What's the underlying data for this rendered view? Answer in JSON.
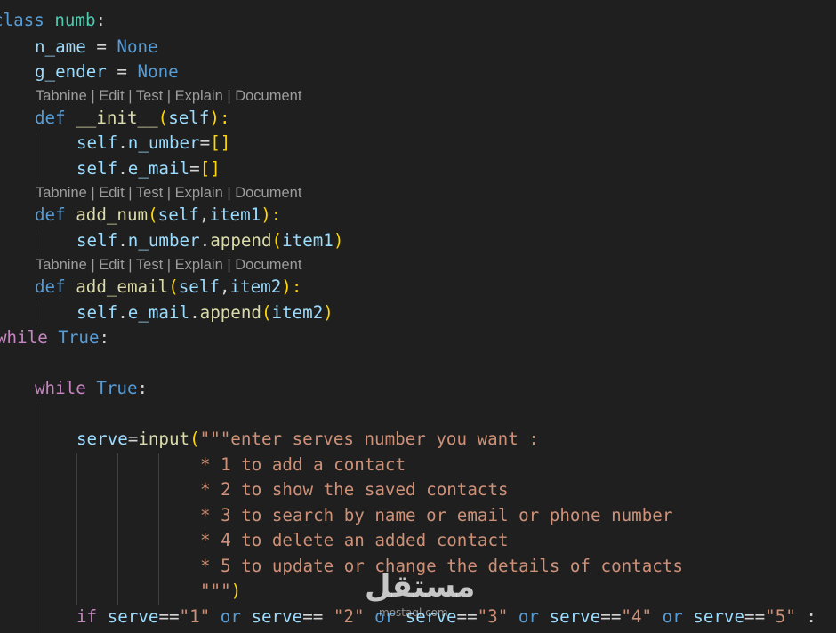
{
  "editor": {
    "l1": {
      "kw": "class",
      "name": "numb",
      "colon": ":"
    },
    "l2": {
      "var": "n_ame",
      "eq": " = ",
      "val": "None"
    },
    "l3": {
      "var": "g_ender",
      "eq": " = ",
      "val": "None"
    },
    "lens_items": [
      "Tabnine",
      "Edit",
      "Test",
      "Explain",
      "Document"
    ],
    "lens_sep": " | ",
    "l4": {
      "kw": "def",
      "fn": "__init__",
      "op": "(",
      "self": "self",
      "cp": "):"
    },
    "l5": {
      "self": "self",
      "dot": ".",
      "attr": "n_umber",
      "eq": "=",
      "br": "[]"
    },
    "l6": {
      "self": "self",
      "dot": ".",
      "attr": "e_mail",
      "eq": "=",
      "br": "[]"
    },
    "l7": {
      "kw": "def",
      "fn": "add_num",
      "op": "(",
      "self": "self",
      "comma": ",",
      "arg": "item1",
      "cp": "):"
    },
    "l8": {
      "self": "self",
      "dot": ".",
      "attr": "n_umber",
      "dot2": ".",
      "method": "append",
      "op": "(",
      "arg": "item1",
      "cp": ")"
    },
    "l9": {
      "kw": "def",
      "fn": "add_email",
      "op": "(",
      "self": "self",
      "comma": ",",
      "arg": "item2",
      "cp": "):"
    },
    "l10": {
      "self": "self",
      "dot": ".",
      "attr": "e_mail",
      "dot2": ".",
      "method": "append",
      "op": "(",
      "arg": "item2",
      "cp": ")"
    },
    "l11": {
      "kw": "while",
      "val": "True",
      "colon": ":"
    },
    "l12": {
      "kw": "while",
      "val": "True",
      "colon": ":"
    },
    "l13": {
      "var": "serve",
      "eq": "=",
      "fn": "input",
      "op": "(",
      "str": "\"\"\"enter serves number you want :"
    },
    "l14": {
      "str": "* 1 to add a contact"
    },
    "l15": {
      "str": "* 2 to show the saved contacts"
    },
    "l16": {
      "str": "* 3 to search by name or email or phone number"
    },
    "l17": {
      "str": "* 4 to delete an added contact"
    },
    "l18": {
      "str": "* 5 to update or change the details of contacts"
    },
    "l19": {
      "str": "\"\"\"",
      "cp": ")"
    },
    "l20": {
      "kw": "if",
      "parts": [
        {
          "var": "serve",
          "op": "==",
          "str": "\"1\""
        },
        {
          "var": "serve",
          "op": "== ",
          "str": "\"2\""
        },
        {
          "var": "serve",
          "op": "==",
          "str": "\"3\""
        },
        {
          "var": "serve",
          "op": "==",
          "str": "\"4\""
        },
        {
          "var": "serve",
          "op": "==",
          "str": "\"5\""
        }
      ],
      "or": "or",
      "colon": ":"
    }
  },
  "watermark": {
    "logo": "مستقل",
    "site": "mostaql.com"
  },
  "colors": {
    "background": "#1f1f1f",
    "keyword_blue": "#569cd6",
    "keyword_purple": "#c586c0",
    "class_teal": "#4ec9b0",
    "variable": "#9cdcfe",
    "function": "#dcdcaa",
    "string": "#ce9178",
    "bracket_gold": "#ffd700",
    "bracket_purple": "#da70d6",
    "codelens_gray": "#9d9d9d"
  }
}
